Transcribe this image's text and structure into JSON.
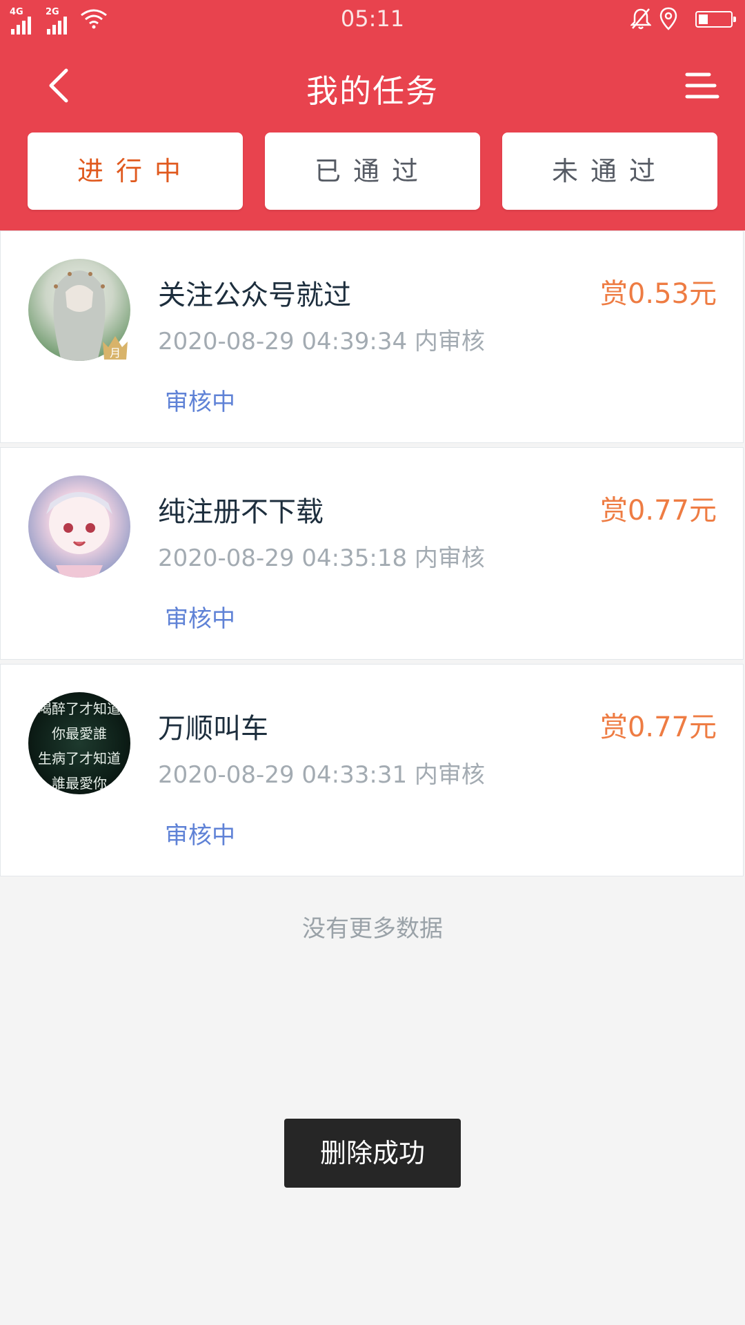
{
  "status_bar": {
    "time": "05:11",
    "sim1_label": "4G",
    "sim2_label": "2G",
    "icons": [
      "signal-icon",
      "wifi-icon",
      "mute-icon",
      "location-icon",
      "battery-icon"
    ],
    "battery_level": 0.3
  },
  "nav": {
    "title": "我的任务",
    "back_icon": "chevron-left-icon",
    "menu_icon": "menu-icon"
  },
  "tabs": [
    {
      "label": "进行中",
      "active": true
    },
    {
      "label": "已通过",
      "active": false
    },
    {
      "label": "未通过",
      "active": false
    }
  ],
  "tasks": [
    {
      "title": "关注公众号就过",
      "reward": "赏0.53元",
      "deadline": "2020-08-29 04:39:34 内审核",
      "status": "审核中",
      "avatar_badge": "月"
    },
    {
      "title": "纯注册不下载",
      "reward": "赏0.77元",
      "deadline": "2020-08-29 04:35:18 内审核",
      "status": "审核中"
    },
    {
      "title": "万顺叫车",
      "reward": "赏0.77元",
      "deadline": "2020-08-29 04:33:31 内审核",
      "status": "审核中",
      "avatar_text": [
        "喝醉了才知道",
        "你最愛誰",
        "生病了才知道",
        "誰最愛你"
      ]
    }
  ],
  "footer": {
    "no_more": "没有更多数据"
  },
  "toast": {
    "message": "删除成功"
  },
  "colors": {
    "header_red": "#e8434e",
    "active_tab_text": "#e05a1f",
    "reward": "#ee7c43",
    "status_blue": "#5f82d6"
  }
}
